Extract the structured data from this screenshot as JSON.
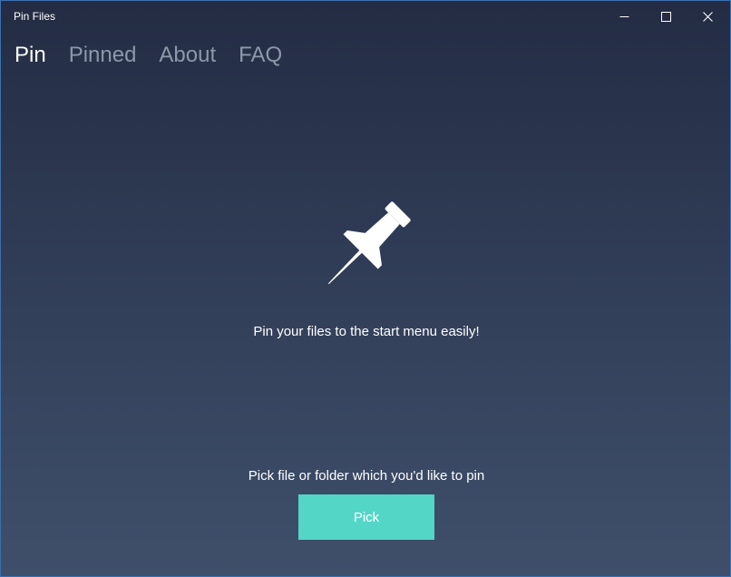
{
  "window": {
    "title": "Pin Files",
    "controls": {
      "minimize_icon": "minimize-icon",
      "maximize_icon": "maximize-icon",
      "close_icon": "close-icon"
    }
  },
  "nav": {
    "items": [
      {
        "label": "Pin",
        "active": true
      },
      {
        "label": "Pinned",
        "active": false
      },
      {
        "label": "About",
        "active": false
      },
      {
        "label": "FAQ",
        "active": false
      }
    ]
  },
  "main": {
    "hero_icon": "pushpin-icon",
    "tagline": "Pin your files to the start menu easily!",
    "prompt": "Pick file or folder which you'd like to pin",
    "pick_label": "Pick"
  },
  "colors": {
    "accent": "#54d6c7",
    "background_top": "#232c43",
    "background_bottom": "#3f4f6a",
    "nav_inactive": "#8d98ab",
    "text": "#ffffff",
    "window_border": "#3c6fb0"
  }
}
